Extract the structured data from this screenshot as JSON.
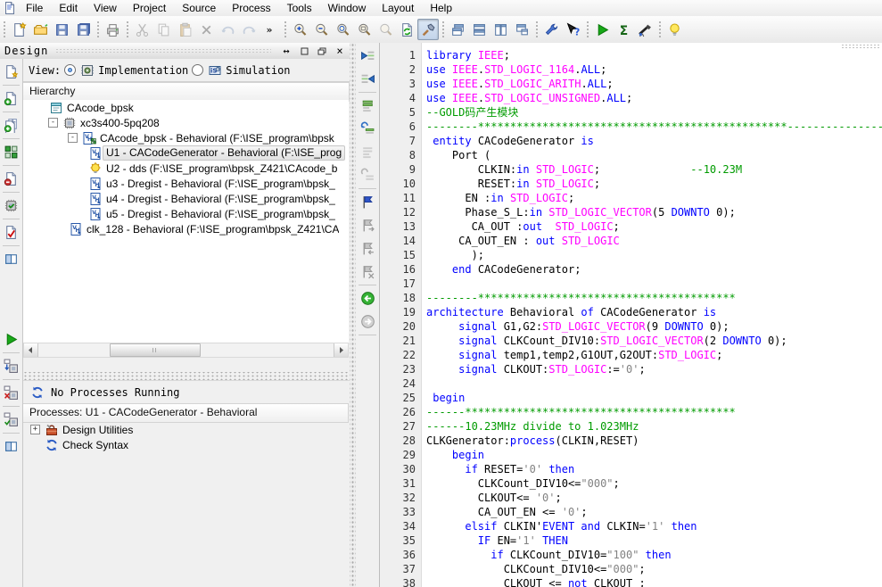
{
  "colors": {
    "keyword": "#0000ff",
    "type": "#ff00ff",
    "comment": "#009b00",
    "string": "#828282",
    "run_green": "#18a818",
    "accent_blue": "#2a5bc4"
  },
  "menu": {
    "items": [
      "File",
      "Edit",
      "View",
      "Project",
      "Source",
      "Process",
      "Tools",
      "Window",
      "Layout",
      "Help"
    ]
  },
  "toolbar": {
    "groups": [
      [
        {
          "n": "new-file"
        },
        {
          "n": "open-file"
        },
        {
          "n": "save"
        },
        {
          "n": "save-all"
        }
      ],
      [
        {
          "n": "print"
        }
      ],
      [
        {
          "n": "cut",
          "s": "d"
        },
        {
          "n": "copy",
          "s": "d"
        },
        {
          "n": "paste",
          "s": "d"
        },
        {
          "n": "delete",
          "s": "d"
        },
        {
          "n": "undo",
          "s": "d"
        },
        {
          "n": "redo",
          "s": "d"
        },
        {
          "n": "overflow"
        }
      ],
      [
        {
          "n": "zoom-in"
        },
        {
          "n": "zoom-out"
        },
        {
          "n": "zoom-full"
        },
        {
          "n": "zoom-selection"
        },
        {
          "n": "find",
          "s": "d"
        },
        {
          "n": "refresh-view"
        },
        {
          "n": "design-toggle",
          "s": "p"
        }
      ],
      [
        {
          "n": "cascade-windows"
        },
        {
          "n": "tile-horizontal"
        },
        {
          "n": "tile-vertical"
        },
        {
          "n": "arrange-windows"
        }
      ],
      [
        {
          "n": "settings-wrench"
        },
        {
          "n": "whats-this"
        }
      ],
      [
        {
          "n": "run"
        },
        {
          "n": "summation"
        },
        {
          "n": "analyze"
        }
      ],
      [
        {
          "n": "tip-of-day"
        }
      ]
    ]
  },
  "design_panel": {
    "title": "Design",
    "view_label": "View:",
    "view_options": [
      {
        "label": "Implementation",
        "icon": "impl",
        "selected": true
      },
      {
        "label": "Simulation",
        "icon": "sim",
        "selected": false
      }
    ],
    "hierarchy_label": "Hierarchy",
    "strip_icons": [
      "new-source",
      "add-source",
      "add-copy-of-source",
      "compile-order",
      "remove-source",
      "device-check",
      "design-rule-check",
      "show-columns"
    ],
    "tree": [
      {
        "label": "CAcode_bpsk",
        "icon": "project",
        "level": 1
      },
      {
        "label": "xc3s400-5pq208",
        "icon": "device",
        "level": 1,
        "expander": "-"
      },
      {
        "label": "CAcode_bpsk - Behavioral (F:\\ISE_program\\bpsk",
        "icon": "vhdl-top",
        "level": 2,
        "expander": "-"
      },
      {
        "label": "U1 - CACodeGenerator - Behavioral (F:\\ISE_prog",
        "icon": "vhdl",
        "level": 3,
        "selected": true
      },
      {
        "label": "U2 - dds (F:\\ISE_program\\bpsk_Z421\\CAcode_b",
        "icon": "core",
        "level": 3
      },
      {
        "label": "u3 - Dregist - Behavioral (F:\\ISE_program\\bpsk_",
        "icon": "vhdl",
        "level": 3
      },
      {
        "label": "u4 - Dregist - Behavioral (F:\\ISE_program\\bpsk_",
        "icon": "vhdl",
        "level": 3
      },
      {
        "label": "u5 - Dregist - Behavioral (F:\\ISE_program\\bpsk_",
        "icon": "vhdl",
        "level": 3
      },
      {
        "label": "clk_128 - Behavioral (F:\\ISE_program\\bpsk_Z421\\CA",
        "icon": "vhdl",
        "level": 2
      }
    ]
  },
  "processes_panel": {
    "status": "No Processes Running",
    "header": "Processes: U1 - CACodeGenerator - Behavioral",
    "strip_icons": [
      "run-process",
      "rerun-process",
      "stop-process",
      "rerun-all",
      "show-columns"
    ],
    "items": [
      {
        "label": "Design Utilities",
        "icon": "toolbox",
        "expander": "+"
      },
      {
        "label": "Check Syntax",
        "icon": "refresh"
      }
    ]
  },
  "editor_strip_icons": [
    "outdent",
    "indent",
    "comment-lines",
    "uncomment-lines",
    "comment-disabled",
    "uncomment-disabled",
    "toggle-bookmark",
    "next-bookmark",
    "prev-bookmark",
    "clear-bookmarks",
    "nav-back",
    "nav-forward"
  ],
  "editor": {
    "lines": [
      {
        "n": 1,
        "t": [
          [
            "k",
            "library"
          ],
          [
            "p",
            " "
          ],
          [
            "y",
            "IEEE"
          ],
          [
            "p",
            ";"
          ]
        ]
      },
      {
        "n": 2,
        "t": [
          [
            "k",
            "use"
          ],
          [
            "p",
            " "
          ],
          [
            "y",
            "IEEE"
          ],
          [
            "p",
            "."
          ],
          [
            "y",
            "STD_LOGIC_1164"
          ],
          [
            "p",
            "."
          ],
          [
            "k",
            "ALL"
          ],
          [
            "p",
            ";"
          ]
        ]
      },
      {
        "n": 3,
        "t": [
          [
            "k",
            "use"
          ],
          [
            "p",
            " "
          ],
          [
            "y",
            "IEEE"
          ],
          [
            "p",
            "."
          ],
          [
            "y",
            "STD_LOGIC_ARITH"
          ],
          [
            "p",
            "."
          ],
          [
            "k",
            "ALL"
          ],
          [
            "p",
            ";"
          ]
        ]
      },
      {
        "n": 4,
        "t": [
          [
            "k",
            "use"
          ],
          [
            "p",
            " "
          ],
          [
            "y",
            "IEEE"
          ],
          [
            "p",
            "."
          ],
          [
            "y",
            "STD_LOGIC_UNSIGNED"
          ],
          [
            "p",
            "."
          ],
          [
            "k",
            "ALL"
          ],
          [
            "p",
            ";"
          ]
        ]
      },
      {
        "n": 5,
        "t": [
          [
            "c",
            "--GOLD码产生模块"
          ]
        ]
      },
      {
        "n": 6,
        "t": [
          [
            "c",
            "--------************************************************------------------------------"
          ]
        ]
      },
      {
        "n": 7,
        "t": [
          [
            "p",
            " "
          ],
          [
            "k",
            "entity"
          ],
          [
            "p",
            " CACodeGenerator "
          ],
          [
            "k",
            "is"
          ]
        ]
      },
      {
        "n": 8,
        "t": [
          [
            "p",
            "    Port ("
          ]
        ]
      },
      {
        "n": 9,
        "t": [
          [
            "p",
            "        CLKIN:"
          ],
          [
            "k",
            "in"
          ],
          [
            "p",
            " "
          ],
          [
            "y",
            "STD_LOGIC"
          ],
          [
            "p",
            ";              "
          ],
          [
            "c",
            "--10.23M"
          ]
        ]
      },
      {
        "n": 10,
        "t": [
          [
            "p",
            "        RESET:"
          ],
          [
            "k",
            "in"
          ],
          [
            "p",
            " "
          ],
          [
            "y",
            "STD_LOGIC"
          ],
          [
            "p",
            ";"
          ]
        ]
      },
      {
        "n": 11,
        "t": [
          [
            "p",
            "      EN :"
          ],
          [
            "k",
            "in"
          ],
          [
            "p",
            " "
          ],
          [
            "y",
            "STD_LOGIC"
          ],
          [
            "p",
            ";"
          ]
        ]
      },
      {
        "n": 12,
        "t": [
          [
            "p",
            "      Phase_S_L:"
          ],
          [
            "k",
            "in"
          ],
          [
            "p",
            " "
          ],
          [
            "y",
            "STD_LOGIC_VECTOR"
          ],
          [
            "p",
            "(5 "
          ],
          [
            "k",
            "DOWNTO"
          ],
          [
            "p",
            " 0);"
          ]
        ]
      },
      {
        "n": 13,
        "t": [
          [
            "p",
            "       CA_OUT :"
          ],
          [
            "k",
            "out"
          ],
          [
            "p",
            "  "
          ],
          [
            "y",
            "STD_LOGIC"
          ],
          [
            "p",
            ";"
          ]
        ]
      },
      {
        "n": 14,
        "t": [
          [
            "p",
            "     CA_OUT_EN : "
          ],
          [
            "k",
            "out"
          ],
          [
            "p",
            " "
          ],
          [
            "y",
            "STD_LOGIC"
          ]
        ]
      },
      {
        "n": 15,
        "t": [
          [
            "p",
            "       );"
          ]
        ]
      },
      {
        "n": 16,
        "t": [
          [
            "p",
            "    "
          ],
          [
            "k",
            "end"
          ],
          [
            "p",
            " CACodeGenerator;"
          ]
        ]
      },
      {
        "n": 17,
        "t": []
      },
      {
        "n": 18,
        "t": [
          [
            "c",
            "--------****************************************"
          ]
        ]
      },
      {
        "n": 19,
        "t": [
          [
            "k",
            "architecture"
          ],
          [
            "p",
            " Behavioral "
          ],
          [
            "k",
            "of"
          ],
          [
            "p",
            " CACodeGenerator "
          ],
          [
            "k",
            "is"
          ]
        ]
      },
      {
        "n": 20,
        "t": [
          [
            "p",
            "     "
          ],
          [
            "k",
            "signal"
          ],
          [
            "p",
            " G1,G2:"
          ],
          [
            "y",
            "STD_LOGIC_VECTOR"
          ],
          [
            "p",
            "(9 "
          ],
          [
            "k",
            "DOWNTO"
          ],
          [
            "p",
            " 0);"
          ]
        ]
      },
      {
        "n": 21,
        "t": [
          [
            "p",
            "     "
          ],
          [
            "k",
            "signal"
          ],
          [
            "p",
            " CLKCount_DIV10:"
          ],
          [
            "y",
            "STD_LOGIC_VECTOR"
          ],
          [
            "p",
            "(2 "
          ],
          [
            "k",
            "DOWNTO"
          ],
          [
            "p",
            " 0);"
          ]
        ]
      },
      {
        "n": 22,
        "t": [
          [
            "p",
            "     "
          ],
          [
            "k",
            "signal"
          ],
          [
            "p",
            " temp1,temp2,G1OUT,G2OUT:"
          ],
          [
            "y",
            "STD_LOGIC"
          ],
          [
            "p",
            ";"
          ]
        ]
      },
      {
        "n": 23,
        "t": [
          [
            "p",
            "     "
          ],
          [
            "k",
            "signal"
          ],
          [
            "p",
            " CLKOUT:"
          ],
          [
            "y",
            "STD_LOGIC"
          ],
          [
            "p",
            ":="
          ],
          [
            "s",
            "'0'"
          ],
          [
            "p",
            ";"
          ]
        ]
      },
      {
        "n": 24,
        "t": []
      },
      {
        "n": 25,
        "t": [
          [
            "p",
            " "
          ],
          [
            "k",
            "begin"
          ]
        ]
      },
      {
        "n": 26,
        "t": [
          [
            "c",
            "------******************************************"
          ]
        ]
      },
      {
        "n": 27,
        "t": [
          [
            "c",
            "------10.23MHz divide to 1.023MHz"
          ]
        ]
      },
      {
        "n": 28,
        "t": [
          [
            "p",
            "CLKGenerator:"
          ],
          [
            "k",
            "process"
          ],
          [
            "p",
            "(CLKIN,RESET)"
          ]
        ]
      },
      {
        "n": 29,
        "t": [
          [
            "p",
            "    "
          ],
          [
            "k",
            "begin"
          ]
        ]
      },
      {
        "n": 30,
        "t": [
          [
            "p",
            "      "
          ],
          [
            "k",
            "if"
          ],
          [
            "p",
            " RESET="
          ],
          [
            "s",
            "'0'"
          ],
          [
            "p",
            " "
          ],
          [
            "k",
            "then"
          ]
        ]
      },
      {
        "n": 31,
        "t": [
          [
            "p",
            "        CLKCount_DIV10<="
          ],
          [
            "s",
            "\"000\""
          ],
          [
            "p",
            ";"
          ]
        ]
      },
      {
        "n": 32,
        "t": [
          [
            "p",
            "        CLKOUT<= "
          ],
          [
            "s",
            "'0'"
          ],
          [
            "p",
            ";"
          ]
        ]
      },
      {
        "n": 33,
        "t": [
          [
            "p",
            "        CA_OUT_EN <= "
          ],
          [
            "s",
            "'0'"
          ],
          [
            "p",
            ";"
          ]
        ]
      },
      {
        "n": 34,
        "t": [
          [
            "p",
            "      "
          ],
          [
            "k",
            "elsif"
          ],
          [
            "p",
            " CLKIN'"
          ],
          [
            "k",
            "EVENT"
          ],
          [
            "p",
            " "
          ],
          [
            "k",
            "and"
          ],
          [
            "p",
            " CLKIN="
          ],
          [
            "s",
            "'1'"
          ],
          [
            "p",
            " "
          ],
          [
            "k",
            "then"
          ]
        ]
      },
      {
        "n": 35,
        "t": [
          [
            "p",
            "        "
          ],
          [
            "k",
            "IF"
          ],
          [
            "p",
            " EN="
          ],
          [
            "s",
            "'1'"
          ],
          [
            "p",
            " "
          ],
          [
            "k",
            "THEN"
          ]
        ]
      },
      {
        "n": 36,
        "t": [
          [
            "p",
            "          "
          ],
          [
            "k",
            "if"
          ],
          [
            "p",
            " CLKCount_DIV10="
          ],
          [
            "s",
            "\"100\""
          ],
          [
            "p",
            " "
          ],
          [
            "k",
            "then"
          ]
        ]
      },
      {
        "n": 37,
        "t": [
          [
            "p",
            "            CLKCount_DIV10<="
          ],
          [
            "s",
            "\"000\""
          ],
          [
            "p",
            ";"
          ]
        ]
      },
      {
        "n": 38,
        "t": [
          [
            "p",
            "            CLKOUT <= "
          ],
          [
            "k",
            "not"
          ],
          [
            "p",
            " CLKOUT ;"
          ]
        ]
      }
    ]
  }
}
